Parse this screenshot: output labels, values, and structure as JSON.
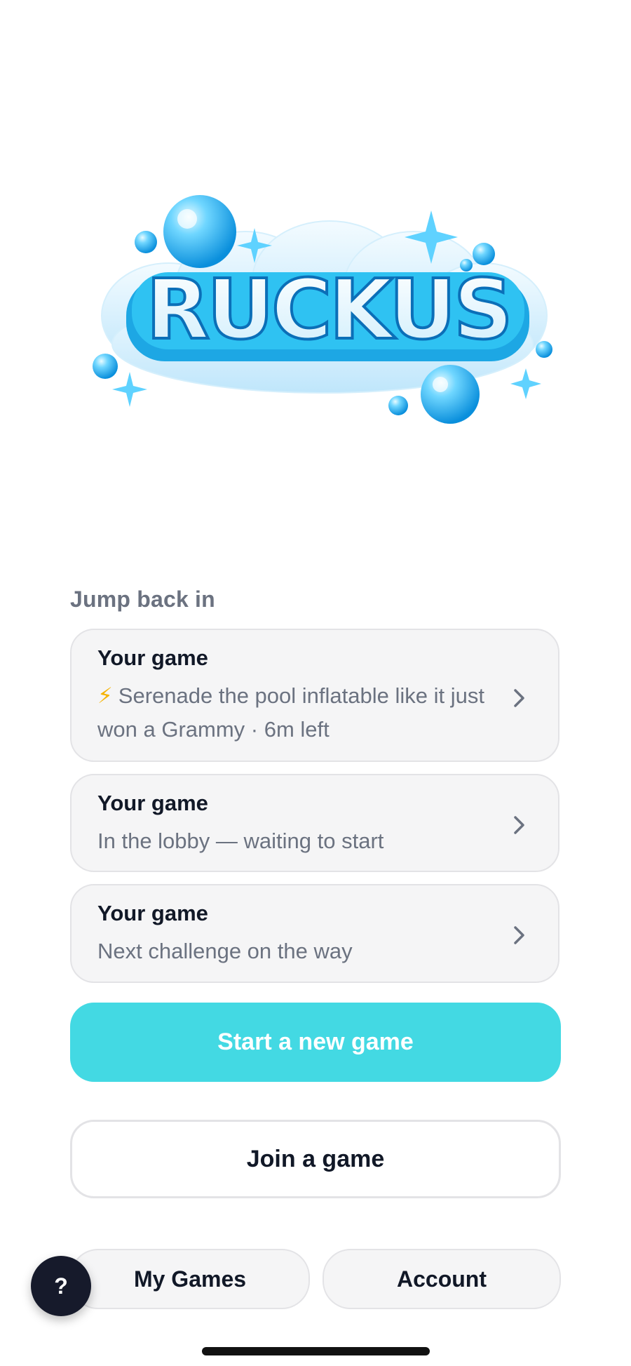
{
  "app": {
    "logo_text": "RUCKUS"
  },
  "section": {
    "heading": "Jump back in"
  },
  "recent_games": [
    {
      "title": "Your game",
      "icon": "lightning-bolt-icon",
      "icon_glyph": "⚡",
      "subtitle": "Serenade the pool inflatable like it just won a Grammy · 6m left"
    },
    {
      "title": "Your game",
      "subtitle": "In the lobby — waiting to start"
    },
    {
      "title": "Your game",
      "subtitle": "Next challenge on the way"
    }
  ],
  "actions": {
    "start_label": "Start a new game",
    "join_label": "Join a game"
  },
  "bottom_nav": {
    "my_games_label": "My Games",
    "account_label": "Account"
  },
  "help": {
    "label": "?"
  },
  "colors": {
    "primary": "#43d9e3",
    "card_bg": "#f5f5f6",
    "card_border": "#e3e3e6",
    "text_dark": "#111827",
    "text_muted": "#6b7280",
    "fab_bg": "#161a2b",
    "bolt": "#f5b301"
  }
}
